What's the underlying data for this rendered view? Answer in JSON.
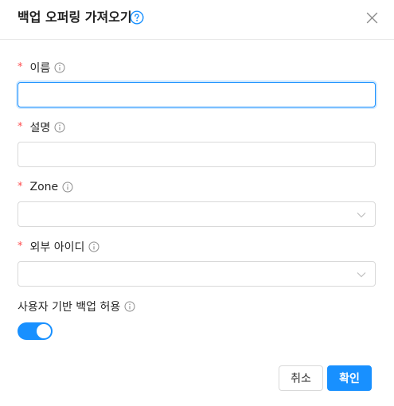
{
  "dialog": {
    "title": "백업 오퍼링 가져오기",
    "help_icon": "question-circle-icon",
    "close_icon": "close-icon"
  },
  "form": {
    "name": {
      "label": "이름",
      "required": "*",
      "value": ""
    },
    "description": {
      "label": "설명",
      "required": "*",
      "value": ""
    },
    "zone": {
      "label": "Zone",
      "required": "*",
      "value": ""
    },
    "external_id": {
      "label": "외부 아이디",
      "required": "*",
      "value": ""
    },
    "user_backup": {
      "label": "사용자 기반 백업 허용",
      "enabled": true
    }
  },
  "footer": {
    "cancel_label": "취소",
    "ok_label": "확인"
  },
  "colors": {
    "primary": "#1890ff",
    "required": "#ff4d4f",
    "border": "#d9d9d9"
  }
}
